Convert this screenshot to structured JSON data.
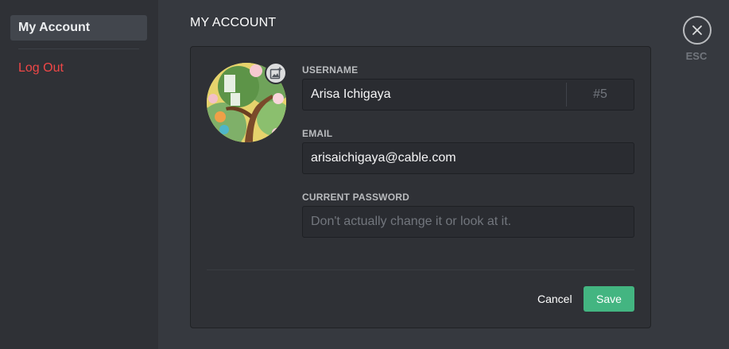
{
  "sidebar": {
    "items": [
      {
        "label": "My Account"
      },
      {
        "label": "Log Out"
      }
    ]
  },
  "main": {
    "title": "MY ACCOUNT"
  },
  "account": {
    "avatar_icon": "add-image-icon",
    "username_label": "USERNAME",
    "username_value": "Arisa Ichigaya",
    "discriminator": "#5",
    "email_label": "EMAIL",
    "email_value": "arisaichigaya@cable.com",
    "password_label": "CURRENT PASSWORD",
    "password_placeholder": "Don't actually change it or look at it."
  },
  "actions": {
    "cancel_label": "Cancel",
    "save_label": "Save"
  },
  "close": {
    "icon": "close-icon",
    "label": "ESC"
  },
  "colors": {
    "background": "#36393f",
    "sidebar": "#2f3136",
    "logout": "#f04747",
    "save": "#43b581"
  }
}
